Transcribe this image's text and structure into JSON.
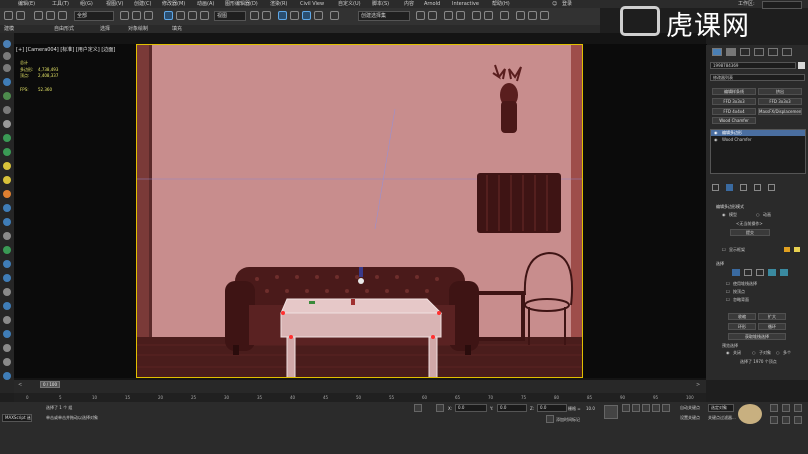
{
  "menubar": {
    "items": [
      "编辑(E)",
      "工具(T)",
      "组(G)",
      "视图(V)",
      "创建(C)",
      "修改器(M)",
      "动画(A)",
      "图形编辑器(D)",
      "渲染(R)",
      "Civil View",
      "自定义(U)",
      "脚本(S)",
      "内容",
      "Arnold",
      "Interactive",
      "帮助(H)"
    ],
    "user": "登录",
    "workspace_label": "工作区:"
  },
  "toolbar": {
    "filter": "全部",
    "view": "视图",
    "selection_set": "创建选择集"
  },
  "ribbon": {
    "tabs": [
      "建模",
      "自由形式",
      "选择",
      "对象绘制",
      "填充"
    ],
    "sub_label": "多边形建模"
  },
  "viewport": {
    "label": "[+] [Camera004] [标准] [用户定义] [边面]",
    "stats": {
      "polys_label": "多边形:",
      "polys_value": "4,738,493",
      "verts_label": "顶点:",
      "verts_value": "2,408,337",
      "fps_label": "FPS:",
      "fps_value": "52.360",
      "total_label": "总计"
    }
  },
  "watermark": {
    "text": "虎课网"
  },
  "cmdpanel": {
    "object_name": "1998784369",
    "modifier_list": "修改器列表",
    "buttons": [
      "编辑样条线",
      "挤出",
      "FFD 3x3x3",
      "FFD 3x3x3",
      "FFD 4x4x4",
      "MassFX/Displacement",
      "Wood Chamfer"
    ],
    "stack_items": [
      "编辑多边形",
      "Wood Chamfer"
    ],
    "rollout_edit": "编辑多边形模式",
    "model_label": "模型",
    "anim_label": "动画",
    "no_op": "<无当前操作>",
    "commit": "提交",
    "show_cage": "显示框架",
    "rollout_select": "选择",
    "by_vertex": "使用堆栈选择",
    "by_angle": "按顶点",
    "ignore_back": "忽略背面",
    "shrink": "收缩",
    "grow": "扩大",
    "ring": "环形",
    "loop": "循环",
    "get_stack": "获取堆栈选择",
    "preview": "预览选择",
    "off": "关闭",
    "subobj": "子对象",
    "multi": "多个",
    "selected": "选择了 1970 个顶点"
  },
  "timeline": {
    "frame_label": "0 / 100",
    "ticks": [
      "0",
      "5",
      "10",
      "15",
      "20",
      "25",
      "30",
      "35",
      "40",
      "45",
      "50",
      "55",
      "60",
      "65",
      "70",
      "75",
      "80",
      "85",
      "90",
      "95",
      "100"
    ]
  },
  "status": {
    "script_label": "MAXScript 迷",
    "selected": "选择了 1 个 组",
    "hint": "单击或单击并拖动以选择对象",
    "x_label": "X:",
    "x_value": "0.0",
    "y_label": "Y:",
    "y_value": "0.0",
    "z_label": "Z:",
    "z_value": "0.0",
    "grid_label": "栅格 =",
    "grid_value": "10.0",
    "add_time_tag": "添加时间标记",
    "auto_key": "自动关键点",
    "set_key": "设置关键点",
    "selected_obj": "选定对象",
    "key_filters": "关键点过滤器..."
  }
}
